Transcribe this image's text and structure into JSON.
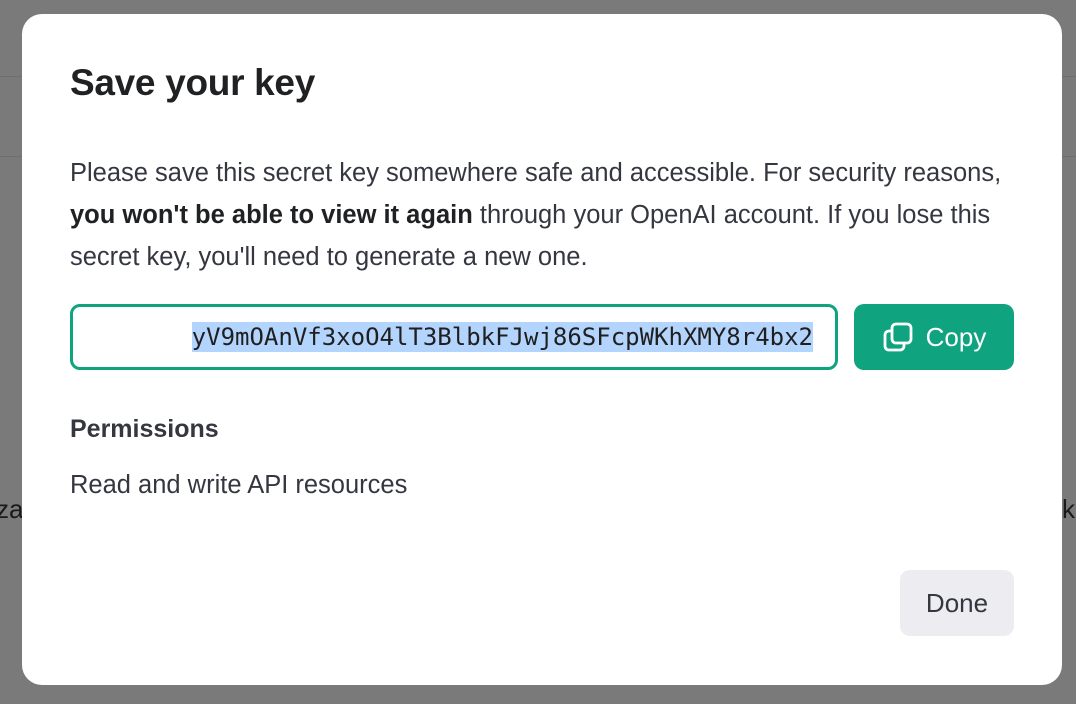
{
  "background": {
    "left_fragment": "za",
    "right_fragment": "ki"
  },
  "modal": {
    "title": "Save your key",
    "description": {
      "part1": "Please save this secret key somewhere safe and accessible. For security reasons, ",
      "bold": "you won't be able to view it again",
      "part2": " through your OpenAI account. If you lose this secret key, you'll need to generate a new one."
    },
    "key_value": "yV9mOAnVf3xoO4lT3BlbkFJwj86SFcpWKhXMY8r4bx2",
    "copy_label": "Copy",
    "permissions_heading": "Permissions",
    "permissions_value": "Read and write API resources",
    "done_label": "Done"
  },
  "colors": {
    "accent": "#10a37f",
    "selection": "#b3d4fc",
    "secondary_button": "#ececf1"
  },
  "icons": {
    "copy": "copy-icon"
  }
}
